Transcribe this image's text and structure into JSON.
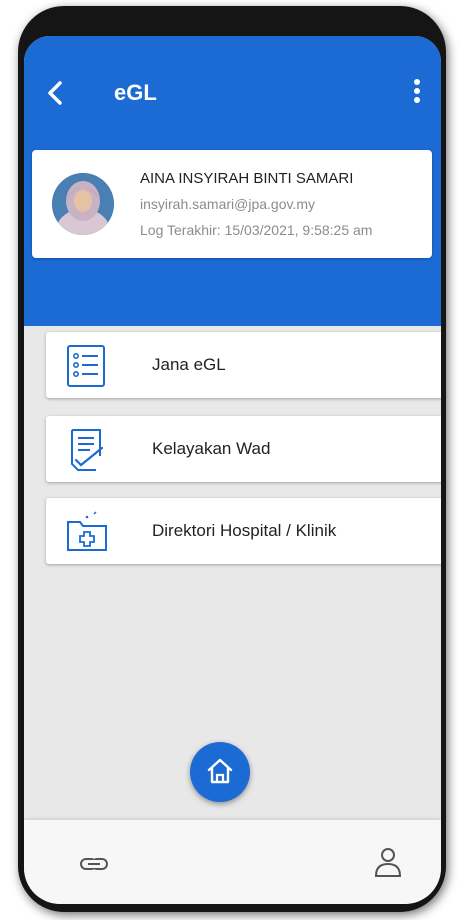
{
  "header": {
    "title": "eGL",
    "back_icon": "chevron-left-icon",
    "menu_icon": "more-vert-icon"
  },
  "profile": {
    "name": "AINA INSYIRAH BINTI SAMARI",
    "email": "insyirah.samari@jpa.gov.my",
    "last_login": "Log Terakhir: 15/03/2021, 9:58:25 am"
  },
  "menu": [
    {
      "label": "Jana eGL",
      "icon": "list-icon"
    },
    {
      "label": "Kelayakan Wad",
      "icon": "checklist-document-icon"
    },
    {
      "label": "Direktori Hospital / Klinik",
      "icon": "medical-folder-icon"
    }
  ],
  "bottom_nav": {
    "left_icon": "link-icon",
    "center_icon": "home-icon",
    "right_icon": "user-icon"
  },
  "colors": {
    "primary": "#1c6bd4",
    "background": "#e8e8e8",
    "icon_stroke": "#1c6bd4"
  }
}
